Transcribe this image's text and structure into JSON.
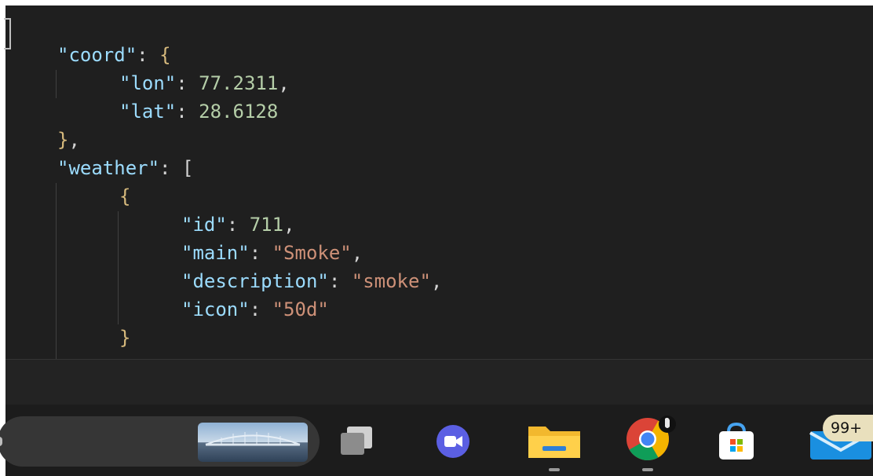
{
  "code_lines": [
    {
      "indent": 0,
      "parts": [
        {
          "t": "\"coord\"",
          "c": "k"
        },
        {
          "t": ": ",
          "c": "p"
        },
        {
          "t": "{",
          "c": "b"
        }
      ]
    },
    {
      "indent": 1,
      "parts": [
        {
          "t": "\"lon\"",
          "c": "k"
        },
        {
          "t": ": ",
          "c": "p"
        },
        {
          "t": "77.2311",
          "c": "n"
        },
        {
          "t": ",",
          "c": "p"
        }
      ]
    },
    {
      "indent": 1,
      "parts": [
        {
          "t": "\"lat\"",
          "c": "k"
        },
        {
          "t": ": ",
          "c": "p"
        },
        {
          "t": "28.6128",
          "c": "n"
        }
      ]
    },
    {
      "indent": 0,
      "parts": [
        {
          "t": "}",
          "c": "b"
        },
        {
          "t": ",",
          "c": "p"
        }
      ]
    },
    {
      "indent": 0,
      "parts": [
        {
          "t": "\"weather\"",
          "c": "k"
        },
        {
          "t": ": ",
          "c": "p"
        },
        {
          "t": "[",
          "c": "sq"
        }
      ]
    },
    {
      "indent": 1,
      "parts": [
        {
          "t": "{",
          "c": "b"
        }
      ]
    },
    {
      "indent": 2,
      "parts": [
        {
          "t": "\"id\"",
          "c": "k"
        },
        {
          "t": ": ",
          "c": "p"
        },
        {
          "t": "711",
          "c": "n"
        },
        {
          "t": ",",
          "c": "p"
        }
      ]
    },
    {
      "indent": 2,
      "parts": [
        {
          "t": "\"main\"",
          "c": "k"
        },
        {
          "t": ": ",
          "c": "p"
        },
        {
          "t": "\"Smoke\"",
          "c": "s"
        },
        {
          "t": ",",
          "c": "p"
        }
      ]
    },
    {
      "indent": 2,
      "parts": [
        {
          "t": "\"description\"",
          "c": "k"
        },
        {
          "t": ": ",
          "c": "p"
        },
        {
          "t": "\"smoke\"",
          "c": "s"
        },
        {
          "t": ",",
          "c": "p"
        }
      ]
    },
    {
      "indent": 2,
      "parts": [
        {
          "t": "\"icon\"",
          "c": "k"
        },
        {
          "t": ": ",
          "c": "p"
        },
        {
          "t": "\"50d\"",
          "c": "s"
        }
      ]
    },
    {
      "indent": 1,
      "parts": [
        {
          "t": "}",
          "c": "b"
        }
      ]
    }
  ],
  "syntax_colors": {
    "key": "#9cdcfe",
    "number": "#b5cea8",
    "string": "#ce9178",
    "brace": "#d7ba7d",
    "background": "#1f1f1f"
  },
  "taskbar": {
    "apps": [
      {
        "name": "task-view-icon",
        "running": false
      },
      {
        "name": "meet-video-icon",
        "running": false
      },
      {
        "name": "file-explorer-icon",
        "running": true
      },
      {
        "name": "chrome-icon",
        "running": true
      },
      {
        "name": "microsoft-store-icon",
        "running": false
      },
      {
        "name": "mail-icon",
        "running": false
      }
    ],
    "notification_badge": "99+"
  }
}
